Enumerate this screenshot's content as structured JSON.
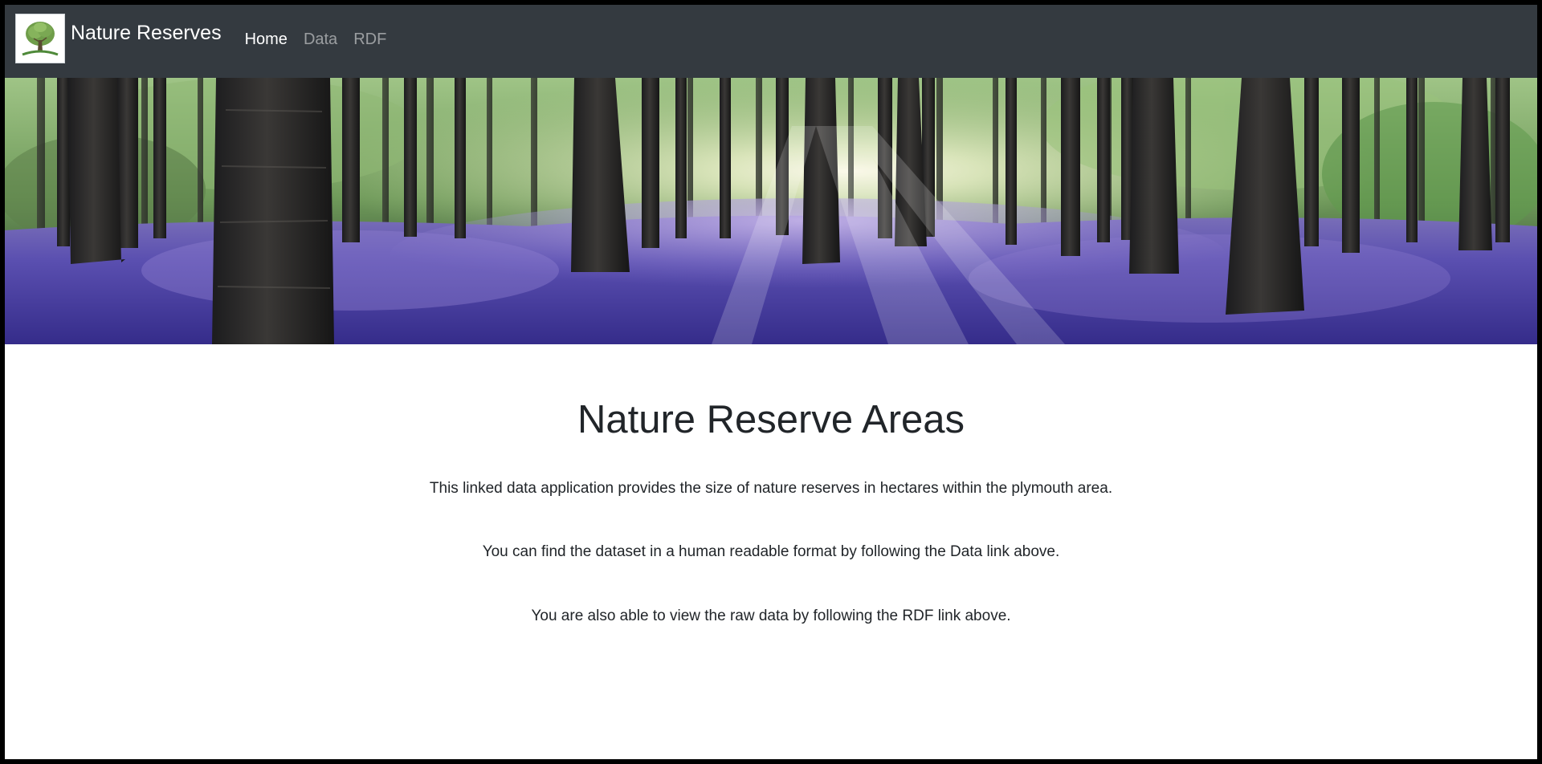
{
  "navbar": {
    "brand": "Nature Reserves",
    "links": [
      {
        "label": "Home",
        "active": true
      },
      {
        "label": "Data",
        "active": false
      },
      {
        "label": "RDF",
        "active": false
      }
    ],
    "background": "#343a40"
  },
  "hero": {
    "image": "bluebell-forest-banner"
  },
  "main": {
    "title": "Nature Reserve Areas",
    "paragraphs": [
      "This linked data application provides the size of nature reserves in hectares within the plymouth area.",
      "You can find the dataset in a human readable format by following the Data link above.",
      "You are also able to view the raw data by following the RDF link above."
    ]
  }
}
